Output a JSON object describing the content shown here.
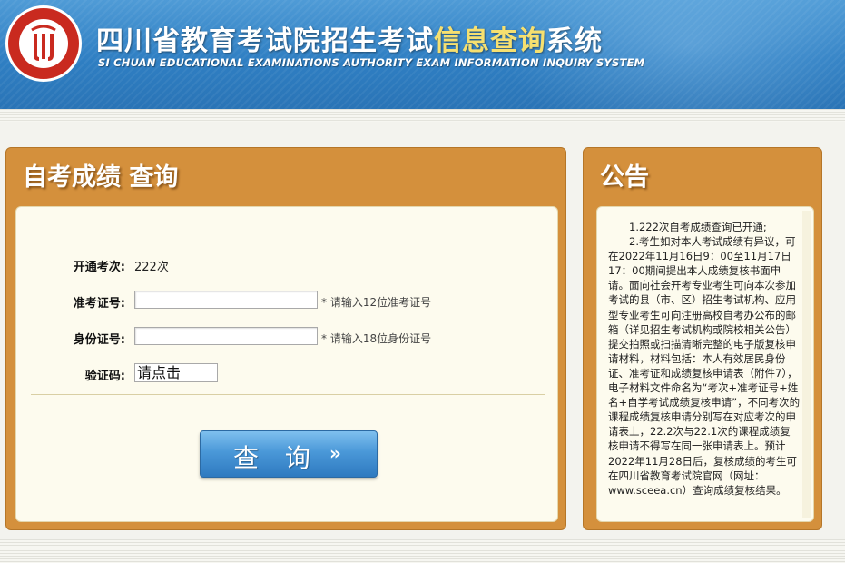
{
  "header": {
    "title_main": "四川省教育考试院招生考试",
    "title_highlight": "信息查询",
    "title_end": "系统",
    "subtitle": "SI CHUAN EDUCATIONAL EXAMINATIONS AUTHORITY EXAM INFORMATION INQUIRY SYSTEM",
    "logo_icon": "sceea-seal-icon"
  },
  "query_panel": {
    "title": "自考成绩  查询",
    "exam_label": "开通考次:",
    "exam_value": "222次",
    "ticket_label": "准考证号:",
    "ticket_value": "",
    "ticket_hint": "* 请输入12位准考证号",
    "id_label": "身份证号:",
    "id_value": "",
    "id_hint": "* 请输入18位身份证号",
    "captcha_label": "验证码:",
    "captcha_text": "请点击",
    "query_button": "查 询",
    "query_arrow": "»"
  },
  "notice_panel": {
    "title": "公告",
    "paragraphs": [
      "1.222次自考成绩查询已开通;",
      "2.考生如对本人考试成绩有异议，可在2022年11月16日9：00至11月17日17：00期间提出本人成绩复核书面申请。面向社会开考专业考生可向本次参加考试的县（市、区）招生考试机构、应用型专业考生可向注册高校自考办公布的邮箱（详见招生考试机构或院校相关公告）提交拍照或扫描清晰完整的电子版复核申请材料，材料包括：本人有效居民身份证、准考证和成绩复核申请表（附件7），电子材料文件命名为“考次+准考证号+姓名+自学考试成绩复核申请”，不同考次的课程成绩复核申请分别写在对应考次的申请表上，22.2次与22.1次的课程成绩复核申请不得写在同一张申请表上。预计2022年11月28日后，复核成绩的考生可在四川省教育考试院官网（网址：www.sceea.cn）查询成绩复核结果。"
    ]
  },
  "colors": {
    "header_blue": "#2f7fc3",
    "title_highlight": "#f6e070",
    "panel_orange": "#d4903c",
    "panel_inner": "#fdfbee",
    "button_blue": "#4a98d8"
  }
}
